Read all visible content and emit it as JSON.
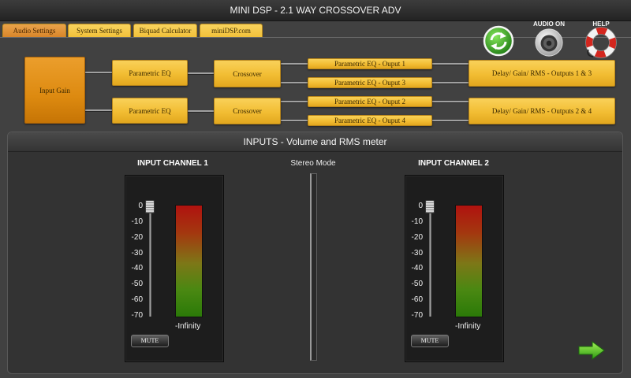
{
  "window": {
    "title": "MINI DSP - 2.1 WAY CROSSOVER ADV"
  },
  "tabs": [
    {
      "label": "Audio Settings",
      "active": true
    },
    {
      "label": "System Settings",
      "active": false
    },
    {
      "label": "Biquad Calculator",
      "active": false
    },
    {
      "label": "miniDSP.com",
      "active": false
    }
  ],
  "toolbar": {
    "refresh_icon": "refresh-icon",
    "audio": {
      "label": "AUDIO ON",
      "icon": "speaker-icon",
      "on": true
    },
    "help": {
      "label": "HELP",
      "icon": "lifebuoy-icon"
    }
  },
  "flow": {
    "input_gain": "Input Gain",
    "rows": [
      {
        "peq": "Parametric EQ",
        "crossover": "Crossover",
        "outputs": [
          "Parametric EQ - Ouput 1",
          "Parametric EQ - Ouput 3"
        ],
        "delay": "Delay/ Gain/ RMS - Outputs 1 & 3"
      },
      {
        "peq": "Parametric EQ",
        "crossover": "Crossover",
        "outputs": [
          "Parametric EQ - Ouput 2",
          "Parametric EQ - Ouput 4"
        ],
        "delay": "Delay/ Gain/ RMS - Outputs 2 & 4"
      }
    ]
  },
  "inputs": {
    "title": "INPUTS - Volume and RMS meter",
    "stereo_mode_label": "Stereo Mode",
    "scale": [
      "0",
      "-10",
      "-20",
      "-30",
      "-40",
      "-50",
      "-60",
      "-70"
    ],
    "channels": [
      {
        "title": "INPUT CHANNEL 1",
        "level": "-Infinity",
        "mute_label": "MUTE",
        "volume_db": 0
      },
      {
        "title": "INPUT CHANNEL 2",
        "level": "-Infinity",
        "mute_label": "MUTE",
        "volume_db": 0
      }
    ]
  },
  "footer": {
    "next_icon": "arrow-right-icon"
  },
  "colors": {
    "block": "#f2bd33",
    "input_gain": "#dd8a10",
    "tab": "#f2c13a",
    "tab_active": "#d9862a",
    "meter_top": "#b0120f",
    "meter_bottom": "#2b7a08"
  }
}
